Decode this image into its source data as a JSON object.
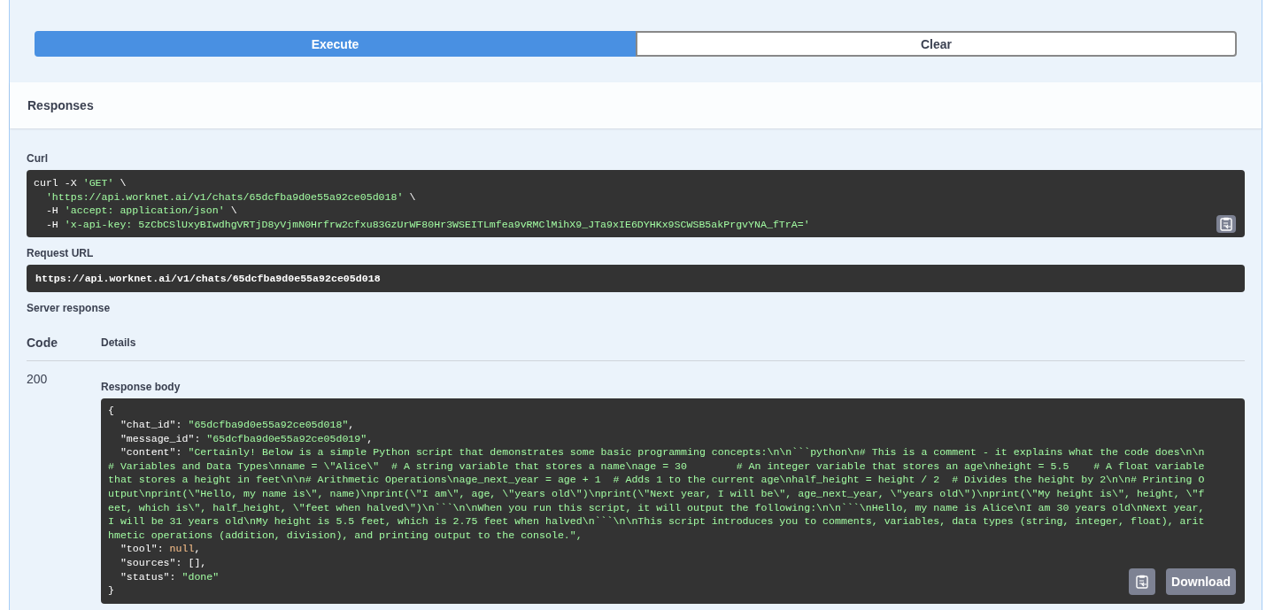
{
  "actions": {
    "execute_button": "Execute",
    "clear_button": "Clear"
  },
  "responses": {
    "title": "Responses",
    "curl": {
      "label": "Curl",
      "lines": [
        [
          {
            "kind": "plain",
            "text": "curl -X "
          },
          {
            "kind": "string",
            "text": "'GET'"
          },
          {
            "kind": "plain",
            "text": " \\"
          }
        ],
        [
          {
            "kind": "string",
            "text": "  'https://api.worknet.ai/v1/chats/65dcfba9d0e55a92ce05d018'"
          },
          {
            "kind": "plain",
            "text": " \\"
          }
        ],
        [
          {
            "kind": "plain",
            "text": "  -H "
          },
          {
            "kind": "string",
            "text": "'accept: application/json'"
          },
          {
            "kind": "plain",
            "text": " \\"
          }
        ],
        [
          {
            "kind": "plain",
            "text": "  -H "
          },
          {
            "kind": "string",
            "text": "'x-api-key: 5zCbCSlUxyBIwdhgVRTjD8yVjmN0Hrfrw2cfxu83GzUrWF80Hr3WSEITLmfea9vRMClMihX9_JTa9xIE6DYHKx9SCWSB5akPrgvYNA_fTrA='"
          }
        ]
      ]
    },
    "request_url": {
      "label": "Request URL",
      "value": "https://api.worknet.ai/v1/chats/65dcfba9d0e55a92ce05d018"
    },
    "server_response": {
      "label": "Server response",
      "columns": [
        "Code",
        "Details"
      ],
      "code": "200",
      "body_label": "Response body",
      "download_button": "Download",
      "body_lines": [
        [
          {
            "kind": "plain",
            "text": "{"
          }
        ],
        [
          {
            "kind": "plain",
            "text": "  \"chat_id\": "
          },
          {
            "kind": "string",
            "text": "\"65dcfba9d0e55a92ce05d018\""
          },
          {
            "kind": "plain",
            "text": ","
          }
        ],
        [
          {
            "kind": "plain",
            "text": "  \"message_id\": "
          },
          {
            "kind": "string",
            "text": "\"65dcfba9d0e55a92ce05d019\""
          },
          {
            "kind": "plain",
            "text": ","
          }
        ],
        [
          {
            "kind": "plain",
            "text": "  \"content\": "
          },
          {
            "kind": "string",
            "text": "\"Certainly! Below is a simple Python script that demonstrates some basic programming concepts:\\n\\n```python\\n# This is a comment - it explains what the code does\\n\\n"
          }
        ],
        [
          {
            "kind": "string",
            "text": "# Variables and Data Types\\nname = \\\"Alice\\\"  # A string variable that stores a name\\nage = 30        # An integer variable that stores an age\\nheight = 5.5    # A float variable"
          }
        ],
        [
          {
            "kind": "string",
            "text": "that stores a height in feet\\n\\n# Arithmetic Operations\\nage_next_year = age + 1  # Adds 1 to the current age\\nhalf_height = height / 2  # Divides the height by 2\\n\\n# Printing O"
          }
        ],
        [
          {
            "kind": "string",
            "text": "utput\\nprint(\\\"Hello, my name is\\\", name)\\nprint(\\\"I am\\\", age, \\\"years old\\\")\\nprint(\\\"Next year, I will be\\\", age_next_year, \\\"years old\\\")\\nprint(\\\"My height is\\\", height, \\\"f"
          }
        ],
        [
          {
            "kind": "string",
            "text": "eet, which is\\\", half_height, \\\"feet when halved\\\")\\n```\\n\\nWhen you run this script, it will output the following:\\n\\n```\\nHello, my name is Alice\\nI am 30 years old\\nNext year,"
          }
        ],
        [
          {
            "kind": "string",
            "text": "I will be 31 years old\\nMy height is 5.5 feet, which is 2.75 feet when halved\\n```\\n\\nThis script introduces you to comments, variables, data types (string, integer, float), arit"
          }
        ],
        [
          {
            "kind": "string",
            "text": "hmetic operations (addition, division), and printing output to the console.\","
          }
        ],
        [
          {
            "kind": "plain",
            "text": "  \"tool\": "
          },
          {
            "kind": "null",
            "text": "null"
          },
          {
            "kind": "plain",
            "text": ","
          }
        ],
        [
          {
            "kind": "plain",
            "text": "  \"sources\": [],"
          }
        ],
        [
          {
            "kind": "plain",
            "text": "  \"status\": "
          },
          {
            "kind": "string",
            "text": "\"done\""
          }
        ],
        [
          {
            "kind": "plain",
            "text": "}"
          }
        ]
      ]
    }
  }
}
